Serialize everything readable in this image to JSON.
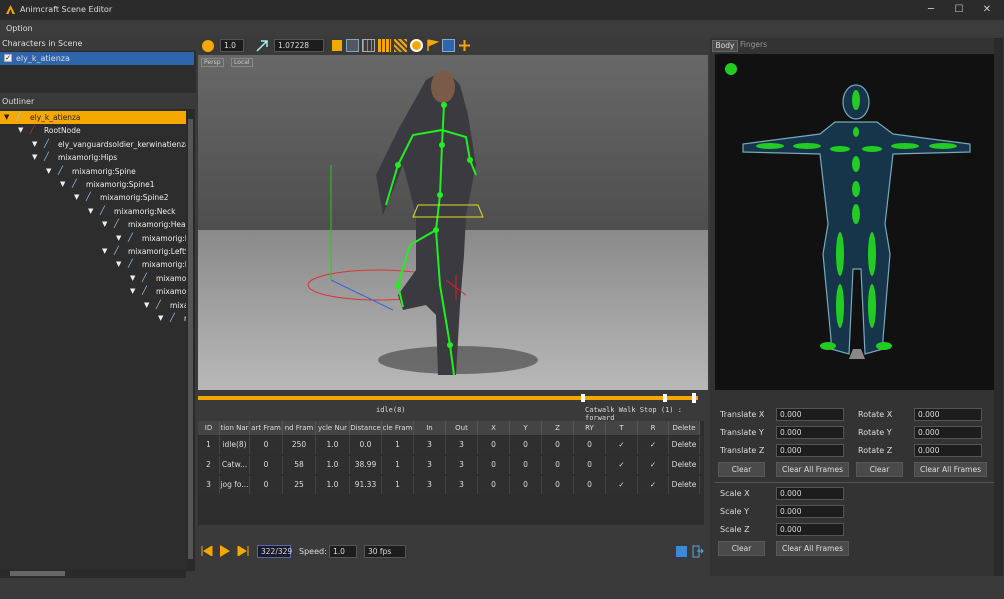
{
  "app": {
    "title": "Animcraft Scene Editor",
    "menu": [
      "Option"
    ]
  },
  "characters_panel": {
    "title": "Characters in Scene",
    "items": [
      {
        "label": "ely_k_atienza",
        "checked": true
      }
    ]
  },
  "outliner": {
    "title": "Outliner",
    "nodes": [
      {
        "label": "ely_k_atienza"
      },
      {
        "label": "RootNode"
      },
      {
        "label": "ely_vanguardsoldier_kerwinatienza_"
      },
      {
        "label": "mixamorig:Hips"
      },
      {
        "label": "mixamorig:Spine"
      },
      {
        "label": "mixamorig:Spine1"
      },
      {
        "label": "mixamorig:Spine2"
      },
      {
        "label": "mixamorig:Neck"
      },
      {
        "label": "mixamorig:Head"
      },
      {
        "label": "mixamorig:H"
      },
      {
        "label": "mixamorig:LeftShou"
      },
      {
        "label": "mixamorig:LeftA"
      },
      {
        "label": "mixamorig:L"
      },
      {
        "label": "mixamo"
      },
      {
        "label": "mixa"
      },
      {
        "label": "r"
      }
    ]
  },
  "toolbar": {
    "speed_value": "1.0",
    "scale_value": "1.07228"
  },
  "viewport": {
    "persp_label": "Persp",
    "local_label": "Local"
  },
  "timeline": {
    "current_clip": "idle(8)",
    "next_clip": "Catwalk Walk Stop (1) : forward"
  },
  "clip_table": {
    "headers": [
      "ID",
      "tion Nar",
      "art Fram",
      "nd Fram",
      "ycle Nur",
      "Distance",
      "cle Fram",
      "In",
      "Out",
      "X",
      "Y",
      "Z",
      "RY",
      "T",
      "R",
      "Delete"
    ],
    "rows": [
      {
        "id": "1",
        "name": "idle(8)",
        "start": "0",
        "end": "250",
        "cycle": "1.0",
        "distance": "0.0",
        "cycle_frame": "1",
        "in": "3",
        "out": "3",
        "x": "0",
        "y": "0",
        "z": "0",
        "ry": "0",
        "t": "✓",
        "r": "✓",
        "delete": "Delete"
      },
      {
        "id": "2",
        "name": "Catw...",
        "start": "0",
        "end": "58",
        "cycle": "1.0",
        "distance": "38.99",
        "cycle_frame": "1",
        "in": "3",
        "out": "3",
        "x": "0",
        "y": "0",
        "z": "0",
        "ry": "0",
        "t": "✓",
        "r": "✓",
        "delete": "Delete"
      },
      {
        "id": "3",
        "name": "jog fo...",
        "start": "0",
        "end": "25",
        "cycle": "1.0",
        "distance": "91.33",
        "cycle_frame": "1",
        "in": "3",
        "out": "3",
        "x": "0",
        "y": "0",
        "z": "0",
        "ry": "0",
        "t": "✓",
        "r": "✓",
        "delete": "Delete"
      }
    ]
  },
  "playback": {
    "frame": "322/329",
    "speed_label": "Speed:",
    "speed": "1.0",
    "fps": "30 fps"
  },
  "body_panel": {
    "tabs": [
      "Body",
      "Fingers"
    ],
    "translate": [
      {
        "label": "Translate X",
        "value": "0.000"
      },
      {
        "label": "Translate Y",
        "value": "0.000"
      },
      {
        "label": "Translate Z",
        "value": "0.000"
      }
    ],
    "rotate": [
      {
        "label": "Rotate X",
        "value": "0.000"
      },
      {
        "label": "Rotate Y",
        "value": "0.000"
      },
      {
        "label": "Rotate Z",
        "value": "0.000"
      }
    ],
    "scale": [
      {
        "label": "Scale X",
        "value": "0.000"
      },
      {
        "label": "Scale Y",
        "value": "0.000"
      },
      {
        "label": "Scale Z",
        "value": "0.000"
      }
    ],
    "clear": "Clear",
    "clear_all": "Clear All Frames"
  },
  "colors": {
    "accent": "#f5a800",
    "selection": "#2f65ad",
    "bone_green": "#22dd22"
  }
}
